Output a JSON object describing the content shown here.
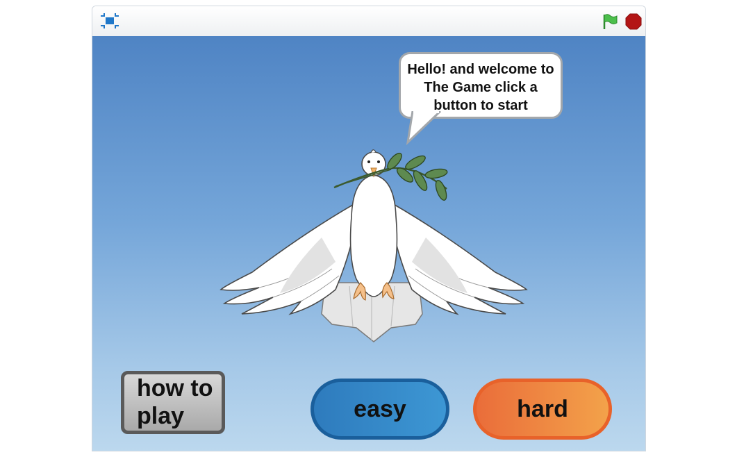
{
  "toolbar": {
    "icons": [
      "fullscreen-icon",
      "green-flag-icon",
      "stop-icon"
    ],
    "colors": {
      "green_flag": "#3db03d",
      "stop": "#b31515"
    }
  },
  "stage": {
    "speech_bubble": "Hello! and welcome to The Game click a button to start",
    "sprite": "dove-with-olive-branch",
    "buttons": {
      "how_to_play": "how to\nplay",
      "easy": "easy",
      "hard": "hard"
    },
    "colors": {
      "sky_top": "#4f84c4",
      "sky_bottom": "#bcd8ee",
      "easy": "#3a8fcf",
      "hard": "#ef8a42",
      "how_to_play": "#b9b9b9"
    }
  }
}
